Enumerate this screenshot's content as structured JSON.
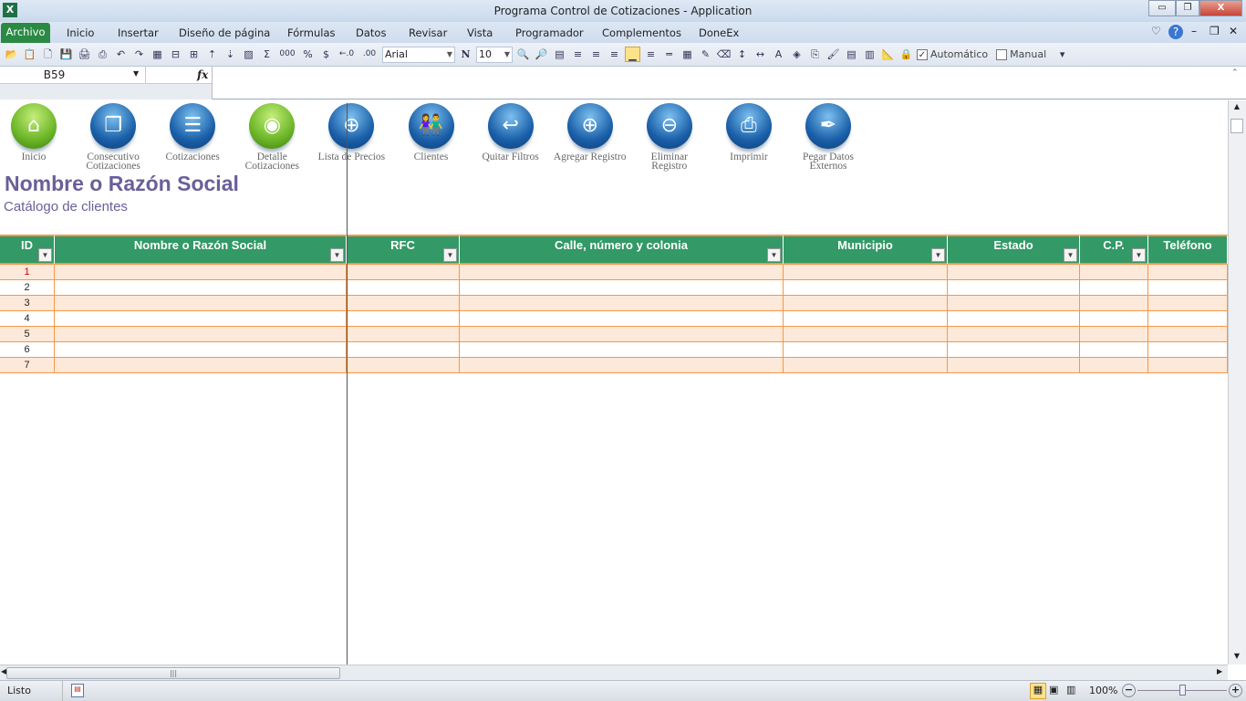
{
  "window": {
    "title": "Programa Control de Cotizaciones  -  Application",
    "app_icon": "X",
    "minimize": "▭",
    "restore": "❐",
    "close": "X"
  },
  "ribbon": {
    "tabs": [
      "Archivo",
      "Inicio",
      "Insertar",
      "Diseño de página",
      "Fórmulas",
      "Datos",
      "Revisar",
      "Vista",
      "Programador",
      "Complementos",
      "DoneEx"
    ],
    "right_icons": [
      "♡",
      "?",
      "–",
      "❐",
      "✕"
    ]
  },
  "toolbar": {
    "icons_left": [
      "📂",
      "📋",
      "🗋",
      "💾",
      "🖨",
      "⎙",
      "↶",
      "↷",
      "▦",
      "⊟",
      "⊞",
      "⇡",
      "⇣",
      "▨",
      "Σ",
      "000",
      "%",
      "$",
      "←.0",
      ".00"
    ],
    "font": "Arial",
    "bold": "N",
    "size": "10",
    "icons_mid": [
      "🔍",
      "🔎",
      "▤",
      "≡",
      "≡",
      "≡",
      "▁",
      "≡",
      "═",
      "▦",
      "✎",
      "⌫",
      "↕",
      "↔",
      "A",
      "◈",
      "⎘",
      "🖌",
      "▤",
      "▥",
      "📐",
      "🔒"
    ],
    "auto_label": "Automático",
    "manual_label": "Manual",
    "more": "▾"
  },
  "formula_bar": {
    "name_box": "B59",
    "fx": "fx",
    "value": ""
  },
  "nav_buttons": [
    {
      "label": "Inicio",
      "icon": "home-icon",
      "glyph": "⌂",
      "color": "green"
    },
    {
      "label": "Consecutivo Cotizaciones",
      "icon": "documents-icon",
      "glyph": "❐",
      "color": "blue"
    },
    {
      "label": "Cotizaciones",
      "icon": "document-icon",
      "glyph": "☰",
      "color": "blue"
    },
    {
      "label": "Detalle Cotizaciones",
      "icon": "disc-icon",
      "glyph": "◉",
      "color": "green"
    },
    {
      "label": "Lista de Precios",
      "icon": "target-icon",
      "glyph": "⊕",
      "color": "blue"
    },
    {
      "label": "Clientes",
      "icon": "people-icon",
      "glyph": "👫",
      "color": "blue"
    },
    {
      "label": "Quitar Filtros",
      "icon": "undo-arrow-icon",
      "glyph": "↩",
      "color": "blue"
    },
    {
      "label": "Agregar Registro",
      "icon": "plus-icon",
      "glyph": "⊕",
      "color": "blue"
    },
    {
      "label": "Eliminar Registro",
      "icon": "minus-icon",
      "glyph": "⊖",
      "color": "blue"
    },
    {
      "label": "Imprimir",
      "icon": "printer-icon",
      "glyph": "⎙",
      "color": "blue"
    },
    {
      "label": "Pegar Datos Externos",
      "icon": "pen-icon",
      "glyph": "✒",
      "color": "blue"
    }
  ],
  "page": {
    "title": "Nombre o Razón Social",
    "subtitle": "Catálogo de clientes"
  },
  "table": {
    "columns": [
      "ID",
      "Nombre o Razón Social",
      "RFC",
      "Calle, número y colonia",
      "Municipio",
      "Estado",
      "C.P.",
      "Teléfono"
    ],
    "rows": [
      [
        "1"
      ],
      [
        "2"
      ],
      [
        "3"
      ],
      [
        "4"
      ],
      [
        "5"
      ],
      [
        "6"
      ],
      [
        "7"
      ]
    ]
  },
  "status": {
    "ready": "Listo",
    "zoom": "100%"
  },
  "colors": {
    "header": "#339966",
    "band": "#fde9d9",
    "border": "#f79646",
    "title": "#6a5f9a"
  }
}
